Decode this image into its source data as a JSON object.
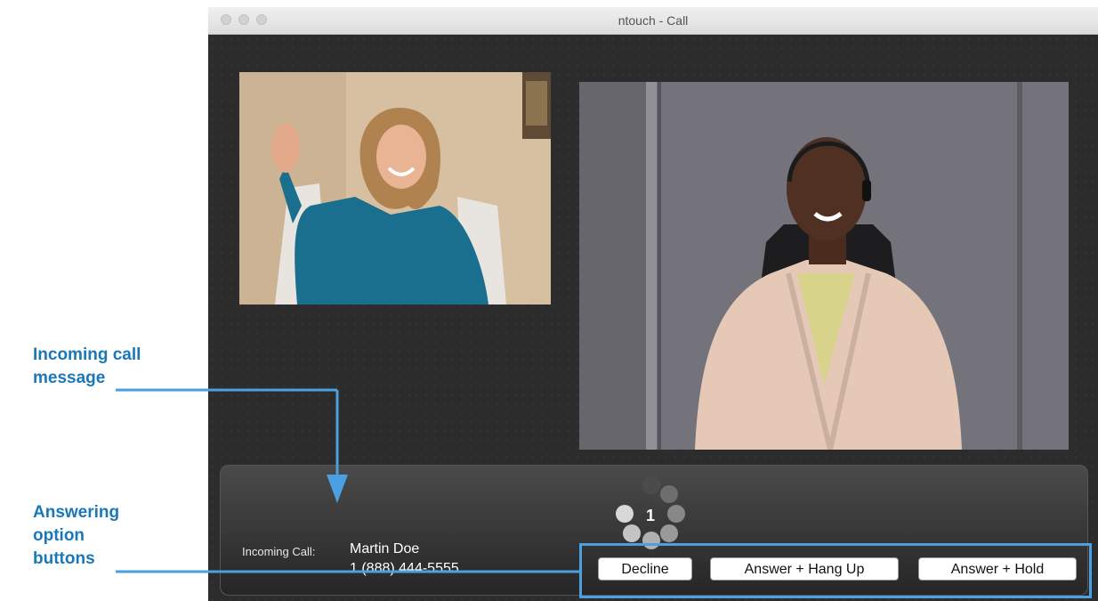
{
  "window": {
    "title": "ntouch - Call"
  },
  "annotations": {
    "incoming_message": [
      "Incoming call",
      "message"
    ],
    "answer_buttons": [
      "Answering",
      "option",
      "buttons"
    ]
  },
  "call": {
    "incoming_label": "Incoming Call:",
    "caller_name": "Martin Doe",
    "caller_number": "1 (888) 444-5555",
    "ring_count": "1"
  },
  "buttons": {
    "decline": "Decline",
    "answer_hang_up": "Answer + Hang Up",
    "answer_hold": "Answer + Hold"
  },
  "colors": {
    "annotation": "#1a78b8",
    "callout": "#4aa0e0",
    "window_bg": "#2b2b2b"
  },
  "icons": [
    "loading-spinner-icon",
    "arrow-icon"
  ]
}
